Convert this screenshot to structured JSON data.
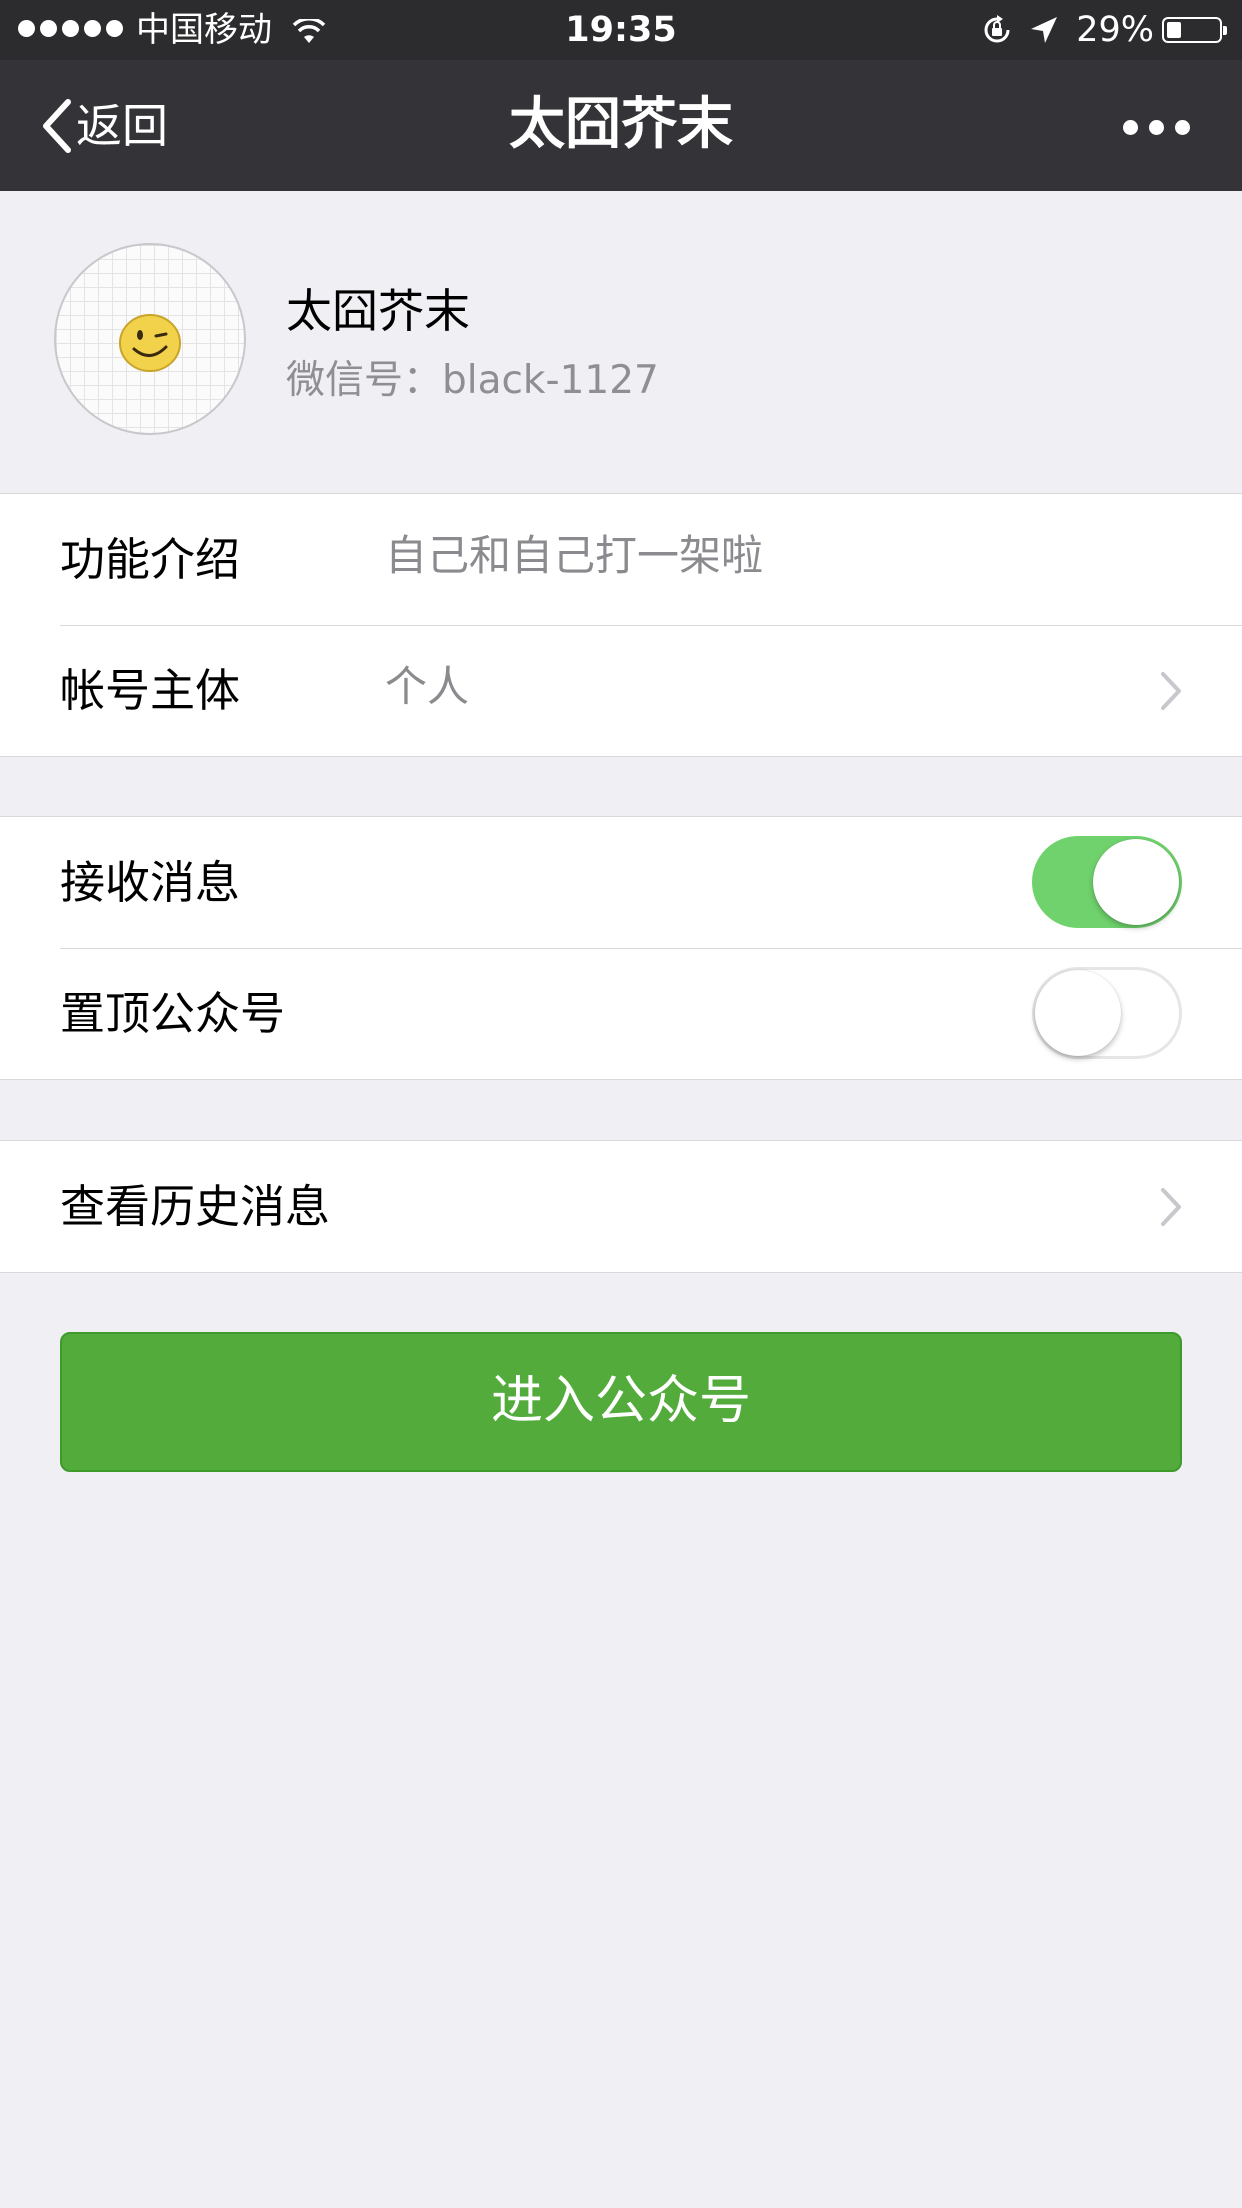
{
  "status_bar": {
    "carrier": "中国移动",
    "time": "19:35",
    "battery_percent": "29%",
    "battery_level": 0.29,
    "signal_dots": 5,
    "icons": [
      "signal-dots-icon",
      "wifi-icon",
      "orientation-lock-icon",
      "location-arrow-icon",
      "battery-icon"
    ]
  },
  "nav": {
    "back_label": "返回",
    "title": "太囧芥末",
    "more_icon": "more-dots-icon"
  },
  "profile": {
    "name": "太囧芥末",
    "wechat_id": "微信号：black-1127",
    "avatar_icon": "winking-smiley-icon"
  },
  "info": {
    "intro_label": "功能介绍",
    "intro_value": "自己和自己打一架啦",
    "owner_label": "帐号主体",
    "owner_value": "个人"
  },
  "settings": {
    "receive_label": "接收消息",
    "receive_on": true,
    "pin_label": "置顶公众号",
    "pin_on": false
  },
  "history": {
    "label": "查看历史消息"
  },
  "enter_button": "进入公众号",
  "colors": {
    "nav_bg": "#343438",
    "page_bg": "#efeff4",
    "toggle_on": "#6fd26c",
    "button_green": "#52ab3a"
  }
}
